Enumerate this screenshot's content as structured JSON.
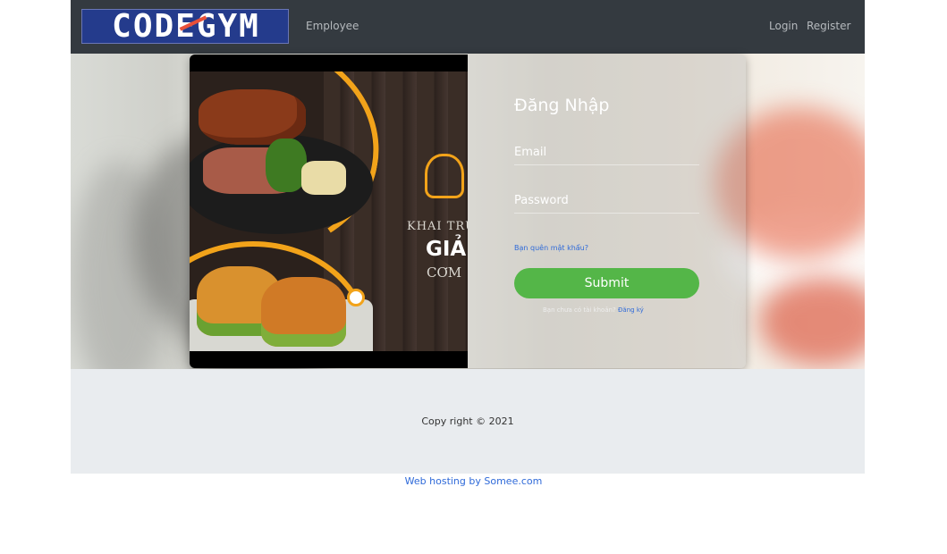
{
  "navbar": {
    "brand": "CODEGYM",
    "employee_link": "Employee",
    "login_link": "Login",
    "register_link": "Register"
  },
  "poster": {
    "line1": "KHAI TRƯ",
    "line2": "GIẢ",
    "line3": "CƠM"
  },
  "login": {
    "title": "Đăng Nhập",
    "email_placeholder": "Email",
    "password_placeholder": "Password",
    "forgot_link": "Bạn quên mật khẩu?",
    "submit_label": "Submit",
    "no_account_text": "Bạn chưa có tài khoản?",
    "register_link": "Đăng ký"
  },
  "footer": {
    "copyright": "Copy right © 2021",
    "hosting": "Web hosting by Somee.com"
  },
  "colors": {
    "navbar_bg": "#343a40",
    "submit_bg": "#54b648",
    "link": "#2f6ad9",
    "footer_bg": "#e9ecef"
  }
}
